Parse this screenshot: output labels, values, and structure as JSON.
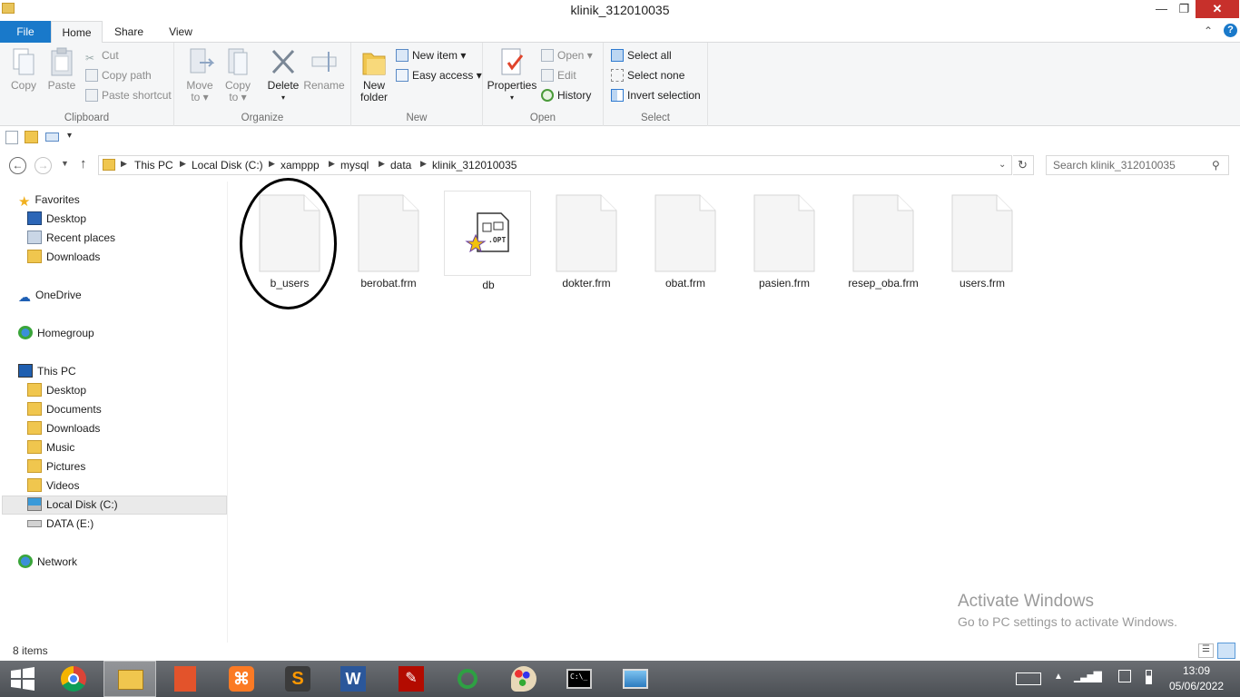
{
  "window": {
    "title": "klinik_312010035",
    "controls": {
      "minimize": "—",
      "maximize": "❐",
      "close": "✕"
    }
  },
  "ribbon_tabs": [
    "File",
    "Home",
    "Share",
    "View"
  ],
  "ribbon": {
    "clipboard": {
      "label": "Clipboard",
      "copy": "Copy",
      "paste": "Paste",
      "cut": "Cut",
      "copy_path": "Copy path",
      "paste_shortcut": "Paste shortcut"
    },
    "organize": {
      "label": "Organize",
      "move_to": "Move",
      "move_to_sub": "to ▾",
      "copy_to": "Copy",
      "copy_to_sub": "to ▾",
      "delete": "Delete",
      "delete_sub": "▾",
      "rename": "Rename"
    },
    "new": {
      "label": "New",
      "new_folder": "New",
      "new_folder_sub": "folder",
      "new_item": "New item ▾",
      "easy_access": "Easy access ▾"
    },
    "open": {
      "label": "Open",
      "properties": "Properties",
      "properties_sub": "▾",
      "open": "Open ▾",
      "edit": "Edit",
      "history": "History"
    },
    "select": {
      "label": "Select",
      "select_all": "Select all",
      "select_none": "Select none",
      "invert_selection": "Invert selection"
    }
  },
  "address": {
    "breadcrumbs": [
      "This PC",
      "Local Disk (C:)",
      "xamppp",
      "mysql",
      "data",
      "klinik_312010035"
    ],
    "search_placeholder": "Search klinik_312010035"
  },
  "navigation": {
    "favorites": {
      "label": "Favorites",
      "items": [
        "Desktop",
        "Recent places",
        "Downloads"
      ]
    },
    "onedrive": "OneDrive",
    "homegroup": "Homegroup",
    "this_pc": {
      "label": "This PC",
      "items": [
        "Desktop",
        "Documents",
        "Downloads",
        "Music",
        "Pictures",
        "Videos",
        "Local Disk (C:)",
        "DATA (E:)"
      ]
    },
    "network": "Network",
    "selected": "Local Disk (C:)"
  },
  "files": [
    {
      "name": "b_users",
      "type": "blank",
      "circled": true
    },
    {
      "name": "berobat.frm",
      "type": "blank"
    },
    {
      "name": "db",
      "type": "opt"
    },
    {
      "name": "dokter.frm",
      "type": "blank"
    },
    {
      "name": "obat.frm",
      "type": "blank"
    },
    {
      "name": "pasien.frm",
      "type": "blank"
    },
    {
      "name": "resep_oba.frm",
      "type": "blank"
    },
    {
      "name": "users.frm",
      "type": "blank"
    }
  ],
  "opt_badge": ".OPT",
  "status": {
    "item_count": "8 items"
  },
  "watermark": {
    "line1": "Activate Windows",
    "line2": "Go to PC settings to activate Windows."
  },
  "taskbar": {
    "apps": [
      "start",
      "chrome",
      "file-explorer",
      "office",
      "xampp",
      "sublime-text",
      "word",
      "acrobat",
      "app-circle",
      "paint",
      "command-prompt",
      "photos"
    ],
    "time": "13:09",
    "date": "05/06/2022"
  },
  "colors": {
    "file_tab": "#1979ca",
    "close_button": "#c7302b",
    "selection": "#eaeaea"
  }
}
